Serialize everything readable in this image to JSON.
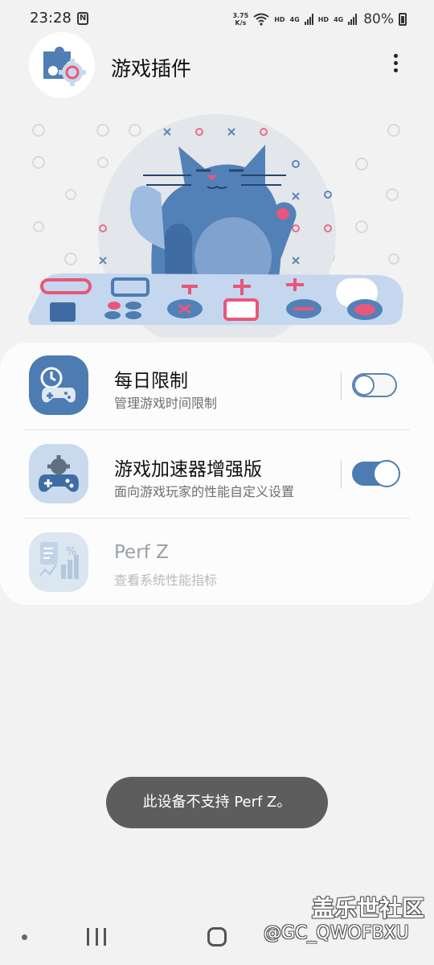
{
  "status_bar": {
    "time": "23:28",
    "nfc_glyph": "N",
    "net_speed_value": "3.75",
    "net_speed_unit": "K/s",
    "hd_label": "HD",
    "lte_label": "4G",
    "battery": "80%"
  },
  "header": {
    "title": "游戏插件",
    "logo_icon": "puzzle-gear-icon",
    "menu_icon": "more-vertical-icon"
  },
  "items": [
    {
      "title": "每日限制",
      "subtitle": "管理游戏时间限制",
      "icon": "gamepad-timer-icon",
      "toggle_on": false
    },
    {
      "title": "游戏加速器增强版",
      "subtitle": "面向游戏玩家的性能自定义设置",
      "icon": "gamepad-gear-icon",
      "toggle_on": true
    },
    {
      "title": "Perf Z",
      "subtitle": "查看系统性能指标",
      "icon": "performance-chart-icon",
      "enabled": false
    }
  ],
  "toast": {
    "message": "此设备不支持 Perf Z。"
  },
  "watermark": {
    "title": "盖乐世社区",
    "handle": "@GC_QWOFBXU"
  },
  "colors": {
    "accent": "#4c7cb1",
    "background": "#f2f2f2",
    "card": "#fcfcfc",
    "toast": "#5d5d5d"
  }
}
